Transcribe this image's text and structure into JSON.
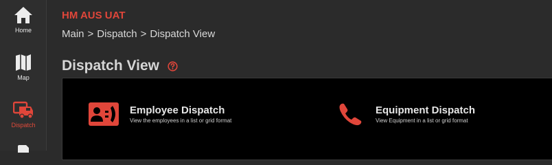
{
  "app_title": "HM AUS UAT",
  "breadcrumb": [
    "Main",
    ">",
    "Dispatch",
    ">",
    "Dispatch View"
  ],
  "page_title": "Dispatch View",
  "colors": {
    "accent": "#e0463a",
    "background": "#2b2b2b",
    "panel": "#000000"
  },
  "sidebar": {
    "items": [
      {
        "label": "Home",
        "icon": "home-icon",
        "active": false
      },
      {
        "label": "Map",
        "icon": "map-icon",
        "active": false
      },
      {
        "label": "Dispatch",
        "icon": "truck-icon",
        "active": true
      }
    ]
  },
  "cards": [
    {
      "title": "Employee Dispatch",
      "description": "View the employees in a list or grid format",
      "icon": "contact-phone-icon"
    },
    {
      "title": "Equipment Dispatch",
      "description": "View Equipment in a list or grid format",
      "icon": "phone-icon"
    }
  ]
}
